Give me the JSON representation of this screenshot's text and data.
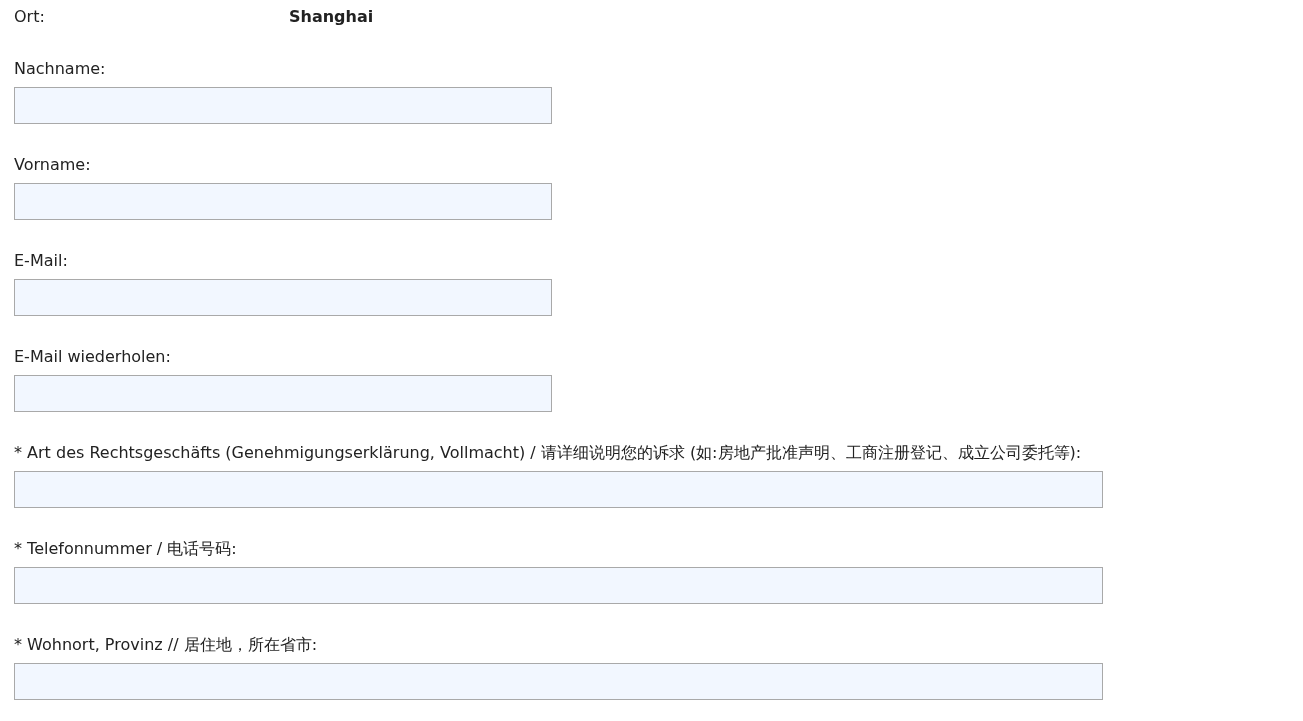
{
  "location": {
    "label": "Ort:",
    "value": "Shanghai"
  },
  "fields": [
    {
      "label": "Nachname:",
      "kind": "short"
    },
    {
      "label": "Vorname:",
      "kind": "short"
    },
    {
      "label": "E-Mail:",
      "kind": "short"
    },
    {
      "label": "E-Mail wiederholen:",
      "kind": "short"
    },
    {
      "label": "* Art des Rechtsgeschäfts (Genehmigungserklärung, Vollmacht) / 请详细说明您的诉求 (如:房地产批准声明、工商注册登记、成立公司委托等):",
      "kind": "wide"
    },
    {
      "label": "* Telefonnummer / 电话号码:",
      "kind": "wide"
    },
    {
      "label": "* Wohnort, Provinz // 居住地，所在省市:",
      "kind": "wide"
    }
  ]
}
